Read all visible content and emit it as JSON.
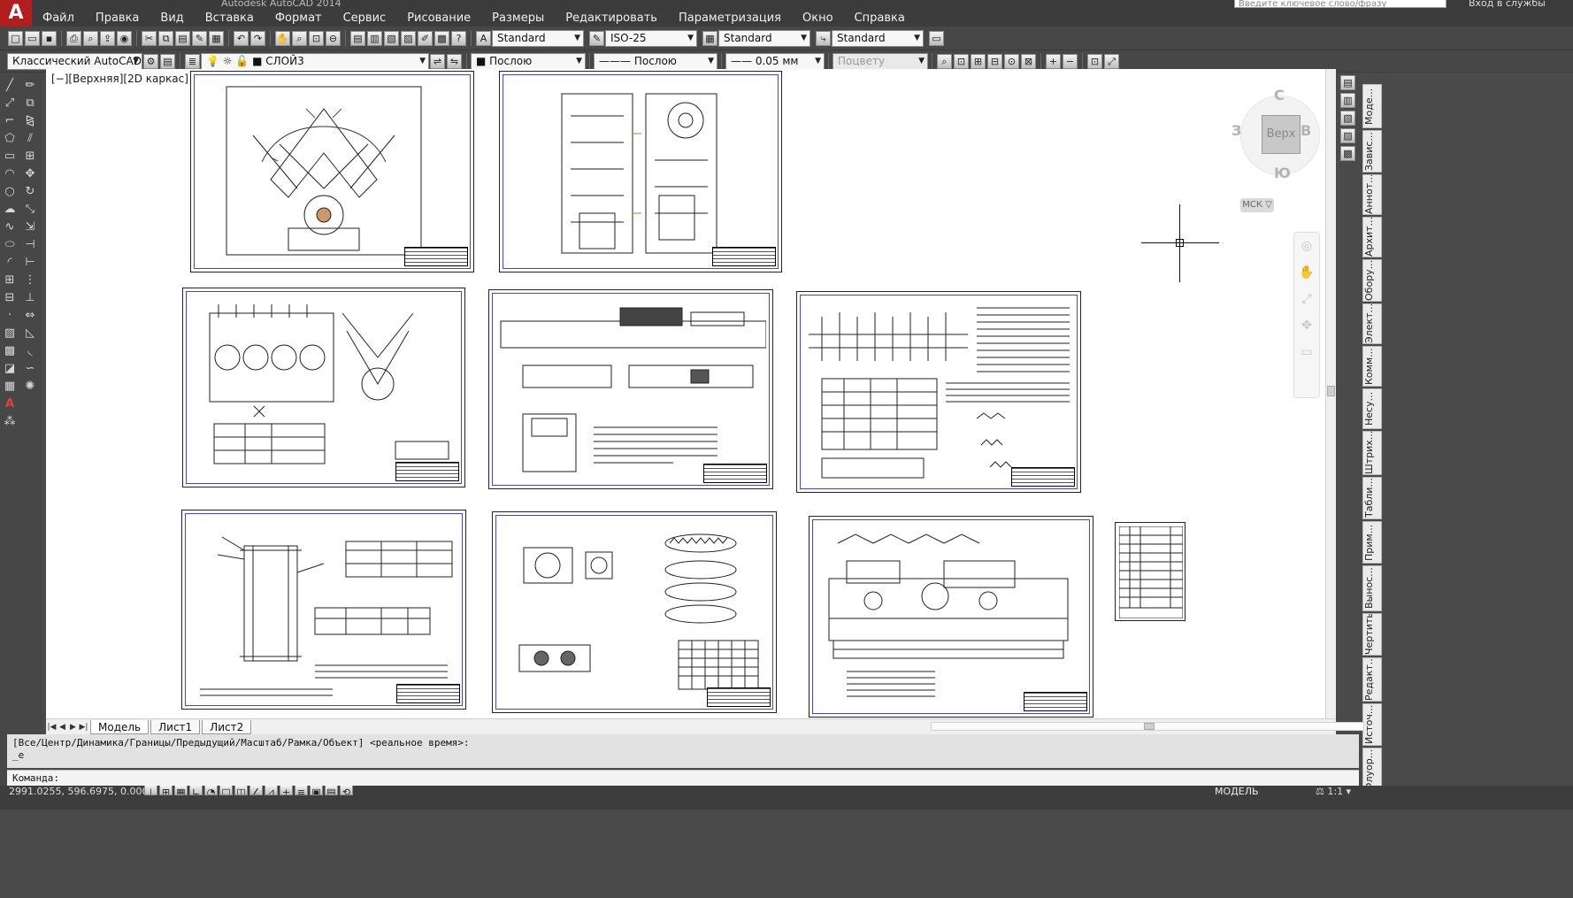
{
  "title_bar": {
    "title": "Autodesk AutoCAD 2014",
    "search_placeholder": "Введите ключевое слово/фразу",
    "login_label": "Вход в службы"
  },
  "app_logo": "A",
  "menu": [
    "Файл",
    "Правка",
    "Вид",
    "Вставка",
    "Формат",
    "Сервис",
    "Рисование",
    "Размеры",
    "Редактировать",
    "Параметризация",
    "Окно",
    "Справка"
  ],
  "toolbar1": {
    "text_style": "Standard",
    "dim_style": "ISO-25",
    "table_style": "Standard",
    "mleader_style": "Standard"
  },
  "toolbar2": {
    "workspace": "Классический AutoCAD",
    "layer": "СЛОЙ3",
    "color": "Послою",
    "linetype": "Послою",
    "lineweight": "0.05 мм",
    "plotstyle": "Поцвету"
  },
  "viewport": {
    "label": "[−][Верхняя][2D каркас]"
  },
  "viewcube": {
    "face": "Верх",
    "north": "С",
    "south": "Ю",
    "east": "В",
    "west": "З",
    "ucs": "МСК"
  },
  "right_tabs": [
    "Моде...",
    "Завис...",
    "Аннот...",
    "Архит...",
    "Обору...",
    "Элект...",
    "Комм...",
    "Несу...",
    "Штрих...",
    "Табли...",
    "Прим...",
    "Вынос...",
    "Чертить",
    "Редакт...",
    "Источ...",
    "Флуор..."
  ],
  "layout_tabs": {
    "model": "Модель",
    "sheet1": "Лист1",
    "sheet2": "Лист2"
  },
  "command": {
    "history_line1": "[Все/Центр/Динамика/Границы/Предыдущий/Масштаб/Рамка/Объект] <реальное время>:",
    "history_line2": "_e",
    "prompt": "Команда:"
  },
  "status": {
    "coordinates": "2991.0255, 596.6975, 0.0000",
    "model": "МОДЕЛЬ",
    "scale": "1:1"
  },
  "icons": {
    "file_new": "file-new-icon",
    "open": "open-icon",
    "save": "save-icon",
    "print": "print-icon",
    "pan": "pan-icon",
    "zoom": "zoom-icon",
    "layer_props": "layer-properties-icon"
  },
  "colors": {
    "canvas_bg": "#ffffff",
    "ui_dark": "#474747",
    "accent_red": "#b21e1e",
    "drawing_blue": "#4040ff"
  }
}
